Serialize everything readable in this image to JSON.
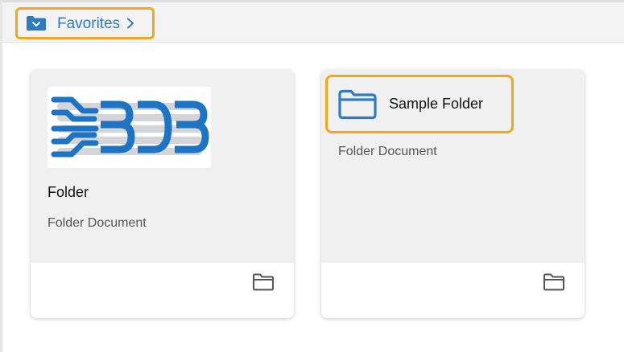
{
  "breadcrumb": {
    "label": "Favorites",
    "icon": "folder-dropdown-icon",
    "chevron": "chevron-right-icon"
  },
  "cards": [
    {
      "title": "Folder",
      "subtitle": "Folder Document",
      "thumbnail": "bdb-logo",
      "footer_icon": "folder-outline-icon"
    },
    {
      "title": "Sample Folder",
      "subtitle": "Folder Document",
      "icon": "folder-icon",
      "footer_icon": "folder-outline-icon"
    }
  ],
  "colors": {
    "accent_blue": "#2e7bc4",
    "highlight_orange": "#f0a91d",
    "card_top_bg": "#f0f0f0"
  }
}
